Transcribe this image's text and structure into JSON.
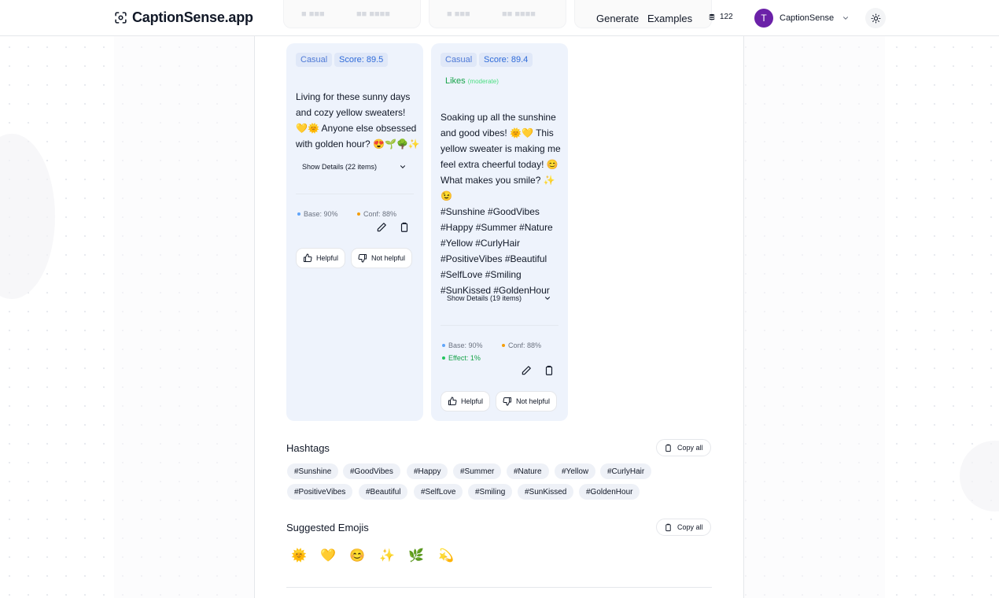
{
  "header": {
    "logo_text": "CaptionSense.app",
    "nav": [
      {
        "label": "Generate"
      },
      {
        "label": "Examples"
      }
    ],
    "credits": "122",
    "user": {
      "initial": "T",
      "name": "CaptionSense"
    }
  },
  "cards": [
    {
      "tone": "Casual",
      "score": "Score: 89.5",
      "caption_lines": [
        "Living for these sunny days",
        "and cozy yellow sweaters!",
        "💛🌞 Anyone else obsessed",
        "with golden hour? 😍🌱🌳✨"
      ],
      "details_label": "Show Details (22 items)",
      "base": "Base: 90%",
      "conf": "Conf: 88%",
      "helpful": "Helpful",
      "not_helpful": "Not helpful"
    },
    {
      "tone": "Casual",
      "score": "Score: 89.4",
      "likes": "Likes",
      "likes_qualifier": "(moderate)",
      "caption_lines": [
        "Soaking up all the sunshine",
        "and good vibes! 🌞💛 This",
        "yellow sweater is making me",
        "feel extra cheerful today! 😊",
        "What makes you smile? ✨😉",
        "#Sunshine #GoodVibes",
        "#Happy #Summer #Nature",
        "#Yellow #CurlyHair",
        "#PositiveVibes #Beautiful",
        "#SelfLove #Smiling",
        "#SunKissed #GoldenHour"
      ],
      "details_label": "Show Details (19 items)",
      "base": "Base: 90%",
      "conf": "Conf: 88%",
      "effect": "Effect: 1%",
      "helpful": "Helpful",
      "not_helpful": "Not helpful"
    }
  ],
  "hashtags": {
    "title": "Hashtags",
    "copy_label": "Copy all",
    "tags": [
      "#Sunshine",
      "#GoodVibes",
      "#Happy",
      "#Summer",
      "#Nature",
      "#Yellow",
      "#CurlyHair",
      "#PositiveVibes",
      "#Beautiful",
      "#SelfLove",
      "#Smiling",
      "#SunKissed",
      "#GoldenHour"
    ]
  },
  "emojis": {
    "title": "Suggested Emojis",
    "copy_label": "Copy all",
    "items": [
      "🌞",
      "💛",
      "😊",
      "✨",
      "🌿",
      "💫"
    ]
  },
  "colors": {
    "accent": "#2f6bd9",
    "card_bg": "#eef3fc",
    "avatar": "#6b21a8",
    "positive": "#16a34a",
    "base_dot": "#60a5fa",
    "conf_dot": "#f59e0b"
  }
}
